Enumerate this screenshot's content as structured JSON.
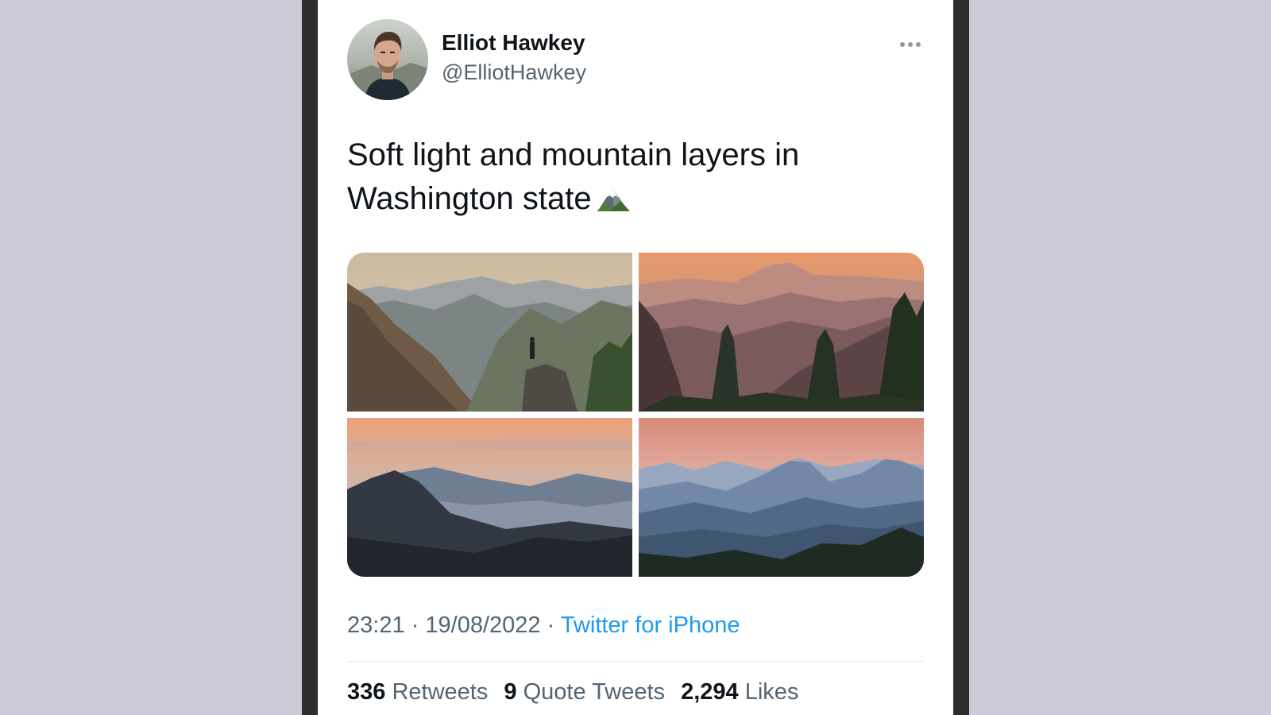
{
  "tweet": {
    "author": {
      "display_name": "Elliot Hawkey",
      "handle": "@ElliotHawkey"
    },
    "text_line1": "Soft light and mountain layers in",
    "text_line2": "Washington state",
    "emoji": "snow-capped-mountain-icon",
    "time": "23:21",
    "date": "19/08/2022",
    "separator": "·",
    "source": "Twitter for iPhone",
    "stats": {
      "retweets_count": "336",
      "retweets_label": "Retweets",
      "quotes_count": "9",
      "quotes_label": "Quote Tweets",
      "likes_count": "2,294",
      "likes_label": "Likes"
    },
    "media_count": 4
  },
  "colors": {
    "link": "#1d9bf0",
    "secondary_text": "#536471",
    "primary_text": "#0f1419",
    "page_background": "#cacbd6",
    "phone_bezel": "#2d2d2f"
  }
}
